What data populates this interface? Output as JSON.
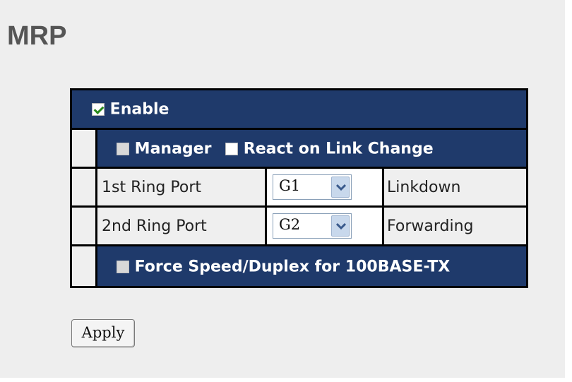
{
  "page": {
    "title": "MRP"
  },
  "mrp": {
    "enable": {
      "label": "Enable",
      "checked": true
    },
    "manager": {
      "label": "Manager",
      "checked": false
    },
    "react_on_link_change": {
      "label": "React on Link Change",
      "checked": false
    },
    "ring_ports": [
      {
        "label": "1st Ring Port",
        "selected": "G1",
        "status": "Linkdown"
      },
      {
        "label": "2nd Ring Port",
        "selected": "G2",
        "status": "Forwarding"
      }
    ],
    "force_speed": {
      "label": "Force Speed/Duplex for 100BASE-TX",
      "checked": false
    }
  },
  "actions": {
    "apply_label": "Apply"
  },
  "colors": {
    "header": "#1f3a6b",
    "panel_background": "#eeeeee",
    "check_green": "#2a8a1c"
  },
  "icons": {
    "checked": "checkbox-checked-icon",
    "unchecked": "checkbox-unchecked-icon",
    "dropdown": "chevron-down-icon"
  }
}
